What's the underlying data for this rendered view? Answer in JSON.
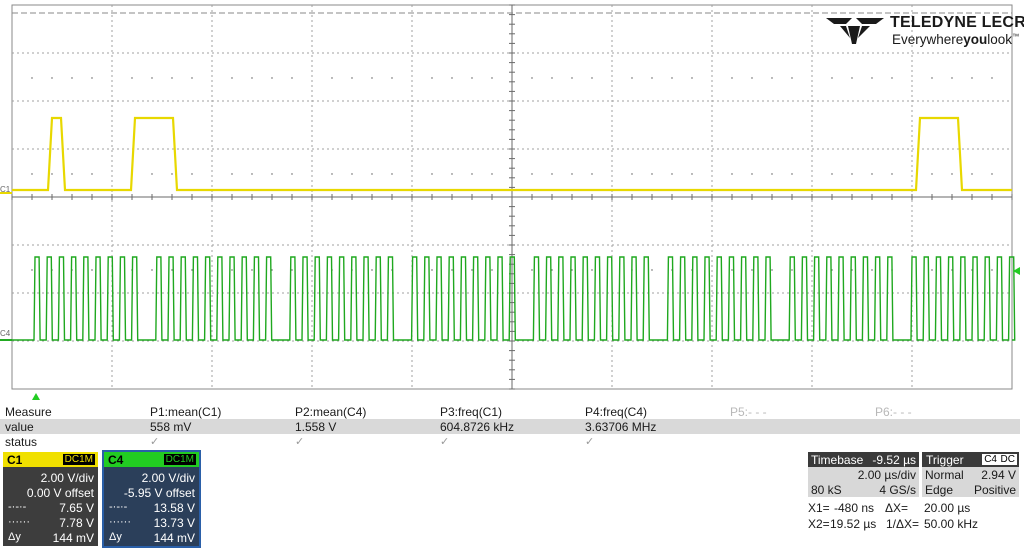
{
  "brand": {
    "name": "TELEDYNE LECROY",
    "tagline_pre": "Everywhere",
    "tagline_bold": "you",
    "tagline_post": "look"
  },
  "colors": {
    "ch1": "#f0e000",
    "ch4": "#22cc22",
    "grid": "#9a9a9a"
  },
  "trace_markers": {
    "ch1": "C1",
    "ch4": "C4"
  },
  "measure": {
    "row_labels": {
      "measure": "Measure",
      "value": "value",
      "status": "status"
    },
    "params": [
      {
        "name": "P1:mean(C1)",
        "value": "558 mV",
        "status": "✓"
      },
      {
        "name": "P2:mean(C4)",
        "value": "1.558 V",
        "status": "✓"
      },
      {
        "name": "P3:freq(C1)",
        "value": "604.8726 kHz",
        "status": "✓"
      },
      {
        "name": "P4:freq(C4)",
        "value": "3.63706 MHz",
        "status": "✓"
      },
      {
        "name": "P5:- - -",
        "value": "",
        "status": ""
      },
      {
        "name": "P6:- - -",
        "value": "",
        "status": ""
      }
    ]
  },
  "channels": {
    "c1": {
      "name": "C1",
      "coupling": "DC1M",
      "vdiv": "2.00 V/div",
      "offset": "0.00 V offset",
      "cur1_sym": "-·-·-",
      "cur1": "7.65 V",
      "cur2_sym": "······",
      "cur2": "7.78 V",
      "dy_label": "Δy",
      "dy": "144 mV"
    },
    "c4": {
      "name": "C4",
      "coupling": "DC1M",
      "vdiv": "2.00 V/div",
      "offset": "-5.95 V offset",
      "cur1_sym": "-·-·-",
      "cur1": "13.58 V",
      "cur2_sym": "······",
      "cur2": "13.73 V",
      "dy_label": "Δy",
      "dy": "144 mV"
    }
  },
  "timebase": {
    "label": "Timebase",
    "position": "-9.52 µs",
    "tdiv": "2.00 µs/div",
    "samples": "80 kS",
    "rate": "4 GS/s"
  },
  "trigger": {
    "label": "Trigger",
    "source": "C4",
    "coupling": "DC",
    "mode": "Normal",
    "level": "2.94 V",
    "type": "Edge",
    "slope": "Positive"
  },
  "cursors": {
    "x1_label": "X1=",
    "x1": "-480 ns",
    "dx_label": "ΔX=",
    "dx": "20.00 µs",
    "x2_label": "X2=",
    "x2": "19.52 µs",
    "invdx_label": "1/ΔX=",
    "invdx": "50.00 kHz"
  }
}
